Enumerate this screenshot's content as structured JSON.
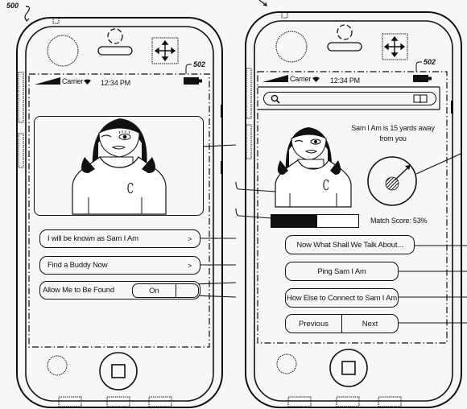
{
  "figure": {
    "ref_device": "500",
    "ref_screen_left": "502",
    "ref_screen_right": "502"
  },
  "left_phone": {
    "status_bar": {
      "carrier": "Carrier",
      "time": "12:34 PM",
      "icons": [
        "signal-icon",
        "wifi-icon",
        "battery-icon"
      ]
    },
    "profile_photo": {
      "shirt_letter": "C"
    },
    "menu": [
      {
        "label": "I will be known as Sam I Am",
        "chevron": ">"
      },
      {
        "label": "Find a Buddy Now",
        "chevron": ">"
      }
    ],
    "toggle_row": {
      "label": "Allow Me to Be Found",
      "state": "On"
    }
  },
  "right_phone": {
    "status_bar": {
      "carrier": "Carrier",
      "time": "12:34 PM",
      "icons": [
        "signal-icon",
        "wifi-icon",
        "battery-icon"
      ]
    },
    "search_bar": {
      "placeholder": "",
      "icons": [
        "search-icon",
        "book-icon"
      ]
    },
    "profile_photo": {
      "shirt_letter": "C"
    },
    "distance_text": "Sam I Am is 15 yards away from you",
    "match": {
      "label": "Match Score: 53%",
      "percent": 53,
      "bar_fraction": 0.53
    },
    "actions": [
      {
        "label": "Now What Shall We Talk About..."
      },
      {
        "label": "Ping Sam I Am"
      },
      {
        "label": "How Else to Connect to Sam I Am"
      }
    ],
    "nav": {
      "previous": "Previous",
      "next": "Next"
    }
  }
}
